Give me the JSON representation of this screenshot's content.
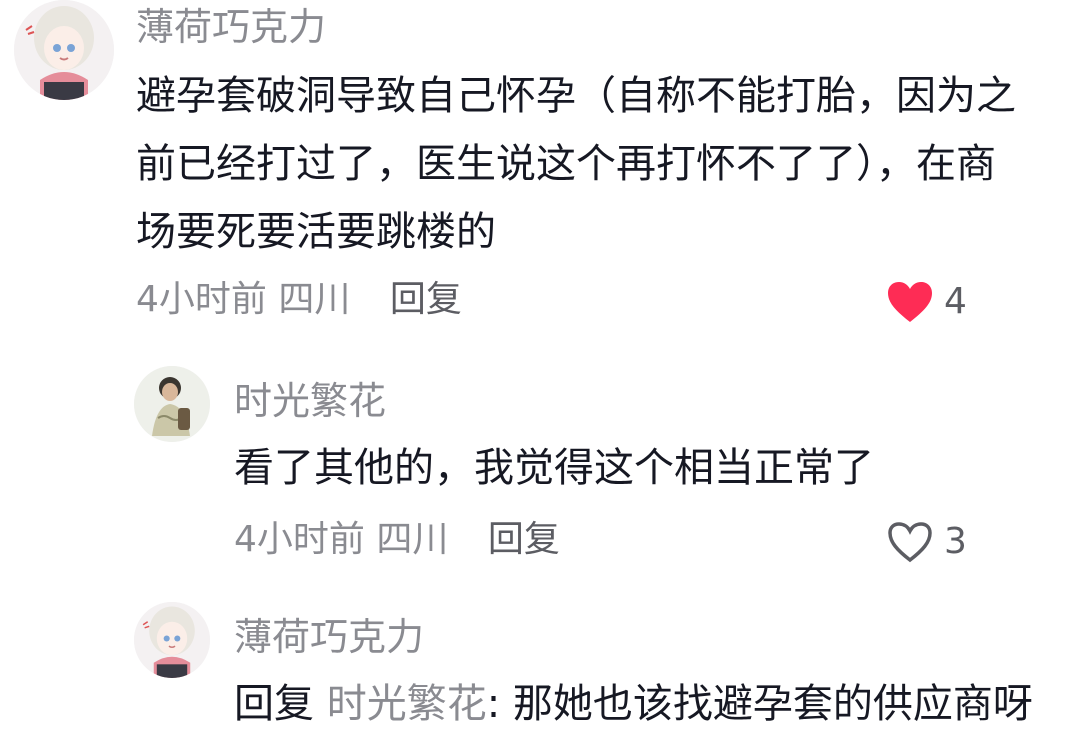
{
  "colors": {
    "username": "#8a8b91",
    "text": "#161823",
    "liked_heart": "#fe2c55",
    "unliked_heart": "#5c5d63"
  },
  "comments": [
    {
      "username": "薄荷巧克力",
      "avatar_icon": "anime-girl-avatar",
      "text_lines": [
        "避孕套破洞导致自己怀孕（自称不能打胎，因为之",
        "前已经打过了，医生说这个再打怀不了了），在商",
        "场要死要活要跳楼的"
      ],
      "time": "4小时前",
      "location": "四川",
      "reply_label": "回复",
      "like_icon": "heart-filled-icon",
      "liked": true,
      "like_count": "4"
    },
    {
      "username": "时光繁花",
      "avatar_icon": "person-photo-avatar",
      "text_lines": [
        "看了其他的，我觉得这个相当正常了"
      ],
      "time": "4小时前",
      "location": "四川",
      "reply_label": "回复",
      "like_icon": "heart-outline-icon",
      "liked": false,
      "like_count": "3"
    },
    {
      "username": "薄荷巧克力",
      "avatar_icon": "anime-girl-avatar",
      "reply_prefix": "回复",
      "mention": "时光繁花",
      "mention_separator": ":",
      "reply_text": "那她也该找避孕套的供应商呀"
    }
  ]
}
